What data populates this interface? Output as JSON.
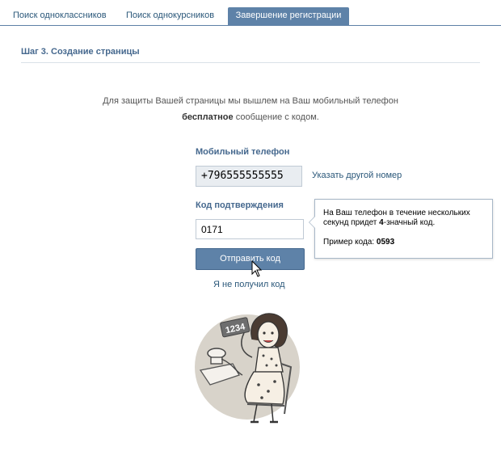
{
  "tabs": [
    {
      "label": "Поиск одноклассников",
      "active": false
    },
    {
      "label": "Поиск однокурсников",
      "active": false
    },
    {
      "label": "Завершение регистрации",
      "active": true
    }
  ],
  "step": {
    "title": "Шаг 3. Создание страницы"
  },
  "info": {
    "line1": "Для защиты Вашей страницы мы вышлем на Ваш мобильный телефон",
    "bold": "бесплатное",
    "line2_rest": " сообщение с кодом."
  },
  "phone": {
    "label": "Мобильный телефон",
    "value": "+796555555555",
    "change_link": "Указать другой номер"
  },
  "code": {
    "label": "Код подтверждения",
    "value": "0171",
    "submit_label": "Отправить код",
    "not_received_link": "Я не получил код"
  },
  "tooltip": {
    "text_pre": "На Ваш телефон в течение нескольких секунд придет ",
    "text_bold": "4",
    "text_post": "-значный код.",
    "example_label": "Пример кода: ",
    "example_code": "0593"
  },
  "illustration": {
    "card_text": "1234"
  },
  "colors": {
    "accent": "#5e82a8",
    "link": "#2b587a",
    "heading": "#45688e"
  }
}
